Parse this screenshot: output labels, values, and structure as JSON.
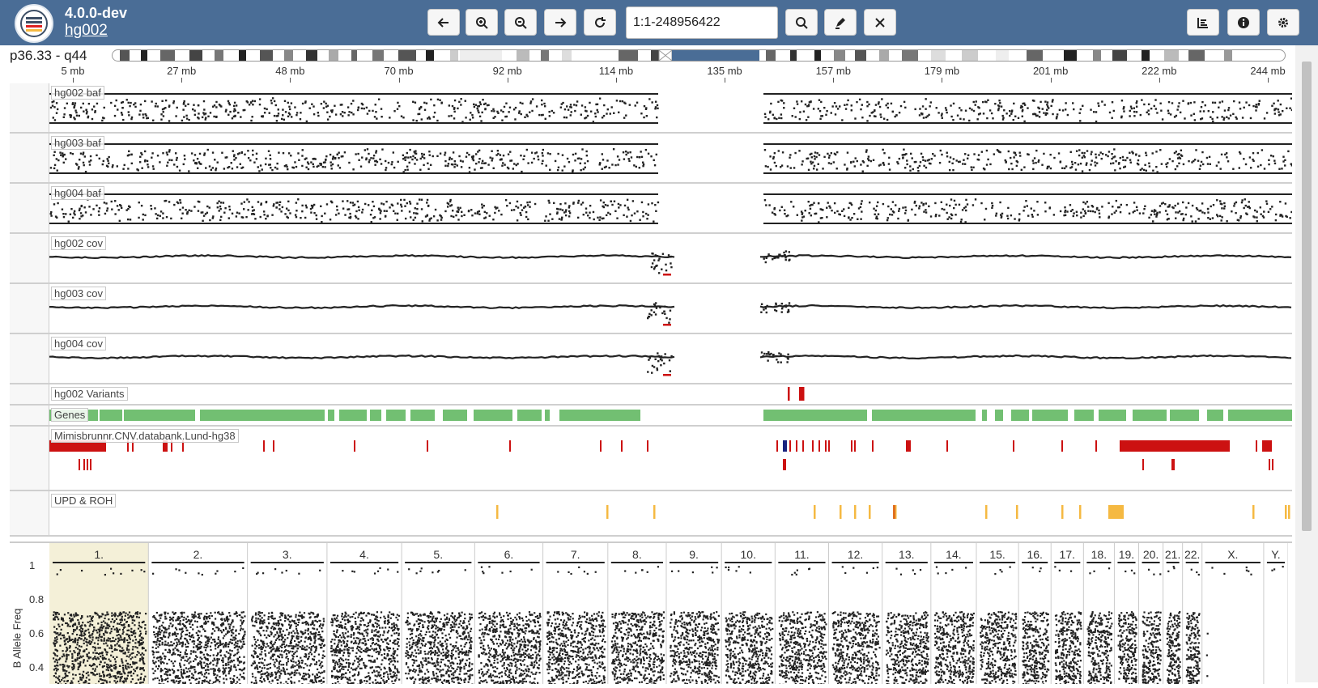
{
  "header": {
    "version": "4.0.0-dev",
    "case_name": "hg002",
    "region_value": "1:1-248956422"
  },
  "toolbar": {
    "buttons": [
      {
        "name": "pan-left-button",
        "icon": "arrow-left-icon",
        "x": 528
      },
      {
        "name": "zoom-in-button",
        "icon": "zoom-in-icon",
        "x": 575
      },
      {
        "name": "zoom-out-button",
        "icon": "zoom-out-icon",
        "x": 623
      },
      {
        "name": "pan-right-button",
        "icon": "arrow-right-icon",
        "x": 672
      },
      {
        "name": "reset-button",
        "icon": "redo-icon",
        "x": 721
      },
      {
        "name": "search-button",
        "icon": "search-icon",
        "x": 970
      },
      {
        "name": "marker-button",
        "icon": "marker-icon",
        "x": 1018
      },
      {
        "name": "clear-button",
        "icon": "close-icon",
        "x": 1067
      },
      {
        "name": "tracks-button",
        "icon": "list-icon",
        "x": 1466
      },
      {
        "name": "info-button",
        "icon": "info-icon",
        "x": 1516
      },
      {
        "name": "settings-button",
        "icon": "gear-icon",
        "x": 1565
      }
    ]
  },
  "ideogram": {
    "label": "p36.33 - q44"
  },
  "ruler": {
    "ticks": [
      "5 mb",
      "27 mb",
      "48 mb",
      "70 mb",
      "92 mb",
      "114 mb",
      "135 mb",
      "157 mb",
      "179 mb",
      "201 mb",
      "222 mb",
      "244 mb"
    ]
  },
  "tracks": [
    {
      "title": "hg002 baf",
      "kind": "baf"
    },
    {
      "title": "hg003 baf",
      "kind": "baf"
    },
    {
      "title": "hg004 baf",
      "kind": "baf"
    },
    {
      "title": "hg002 cov",
      "kind": "cov"
    },
    {
      "title": "hg003 cov",
      "kind": "cov"
    },
    {
      "title": "hg004 cov",
      "kind": "cov"
    },
    {
      "title": "hg002 Variants",
      "kind": "variants"
    },
    {
      "title": "Genes",
      "kind": "genes"
    },
    {
      "title": "Mimisbrunnr.CNV.databank.Lund-hg38",
      "kind": "cnv"
    },
    {
      "title": "UPD & ROH",
      "kind": "upd"
    }
  ],
  "overview": {
    "ylabel": "B Allele Freq",
    "yticks": [
      "1",
      "0.8",
      "0.6",
      "0.4"
    ],
    "chromosomes": [
      "1.",
      "2.",
      "3.",
      "4.",
      "5.",
      "6.",
      "7.",
      "8.",
      "9.",
      "10.",
      "11.",
      "12.",
      "13.",
      "14.",
      "15.",
      "16.",
      "17.",
      "18.",
      "19.",
      "20.",
      "21.",
      "22.",
      "X.",
      "Y."
    ],
    "selected": "1."
  },
  "colors": {
    "header_bg": "#4a6d96",
    "gene_green": "#72bf72",
    "cnv_red": "#cc1111",
    "upd_orange": "#f5b942",
    "selected_chrom_bg": "#f4f0d8"
  }
}
